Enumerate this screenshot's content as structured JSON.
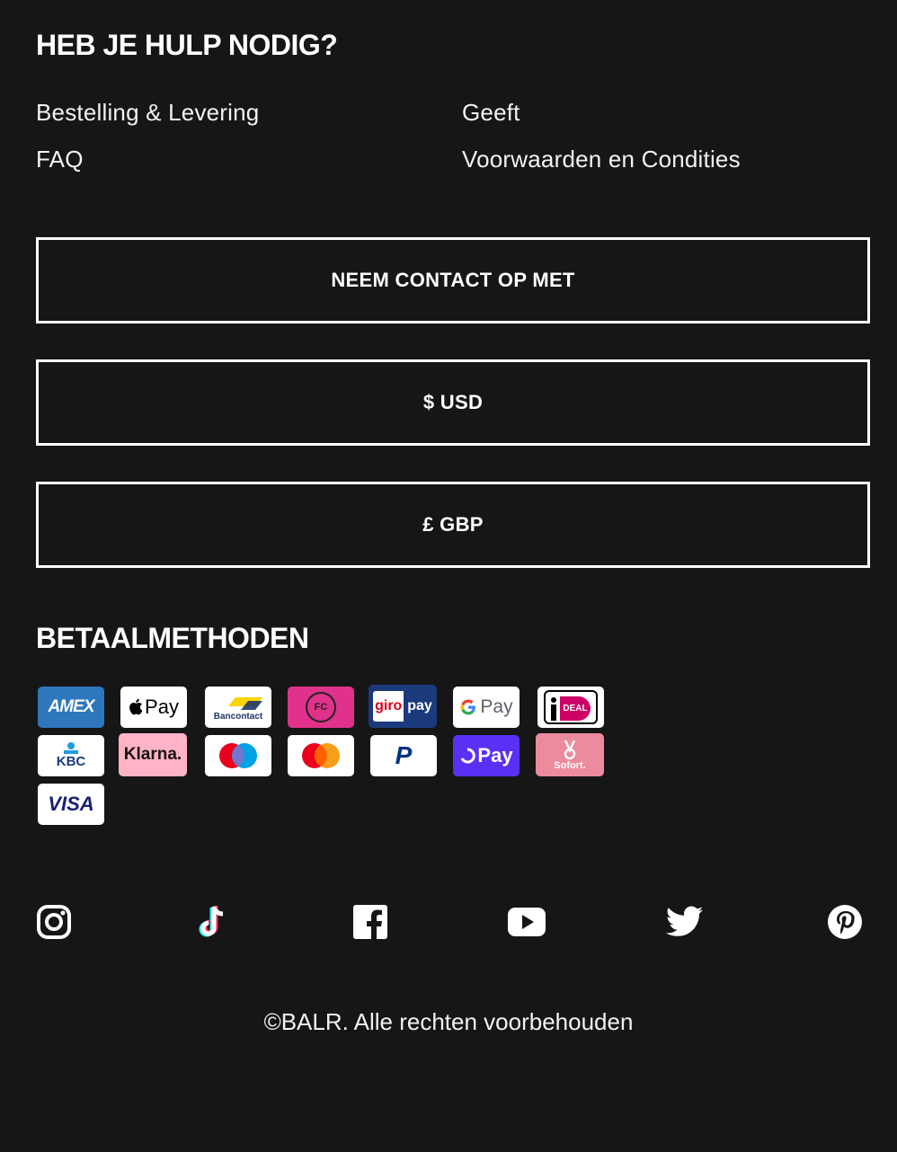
{
  "help": {
    "title": "HEB JE HULP NODIG?",
    "links": [
      "Bestelling & Levering",
      "Geeft",
      "FAQ",
      "Voorwaarden en Condities"
    ]
  },
  "buttons": {
    "contact": "NEEM CONTACT OP MET",
    "usd": "$ USD",
    "gbp": "£ GBP"
  },
  "payment": {
    "title": "BETAALMETHODEN",
    "methods": [
      {
        "name": "amex-icon",
        "label": "AMEX"
      },
      {
        "name": "apple-pay-icon",
        "label": "Pay"
      },
      {
        "name": "bancontact-icon",
        "label": "Bancontact"
      },
      {
        "name": "fc-icon",
        "label": "FC"
      },
      {
        "name": "giropay-icon",
        "label_a": "giro",
        "label_b": "pay"
      },
      {
        "name": "google-pay-icon",
        "label": "Pay"
      },
      {
        "name": "ideal-icon",
        "label": "DEAL"
      },
      {
        "name": "kbc-icon",
        "label": "KBC"
      },
      {
        "name": "klarna-icon",
        "label": "Klarna."
      },
      {
        "name": "maestro-icon"
      },
      {
        "name": "mastercard-icon"
      },
      {
        "name": "paypal-icon",
        "label": "P"
      },
      {
        "name": "shop-pay-icon",
        "label": "Pay"
      },
      {
        "name": "sofort-icon",
        "label": "Sofort."
      },
      {
        "name": "visa-icon",
        "label": "VISA"
      }
    ]
  },
  "social": [
    "instagram-icon",
    "tiktok-icon",
    "facebook-icon",
    "youtube-icon",
    "twitter-icon",
    "pinterest-icon"
  ],
  "footer": {
    "copyright": "©BALR. Alle rechten voorbehouden"
  },
  "colors": {
    "background": "#161616",
    "amex": "#2e77bc",
    "fc": "#e0328a",
    "giropay": "#1a3a7c",
    "klarna": "#ffb3c7",
    "shop_pay": "#5a31f4",
    "sofort": "#ec8a9e"
  }
}
